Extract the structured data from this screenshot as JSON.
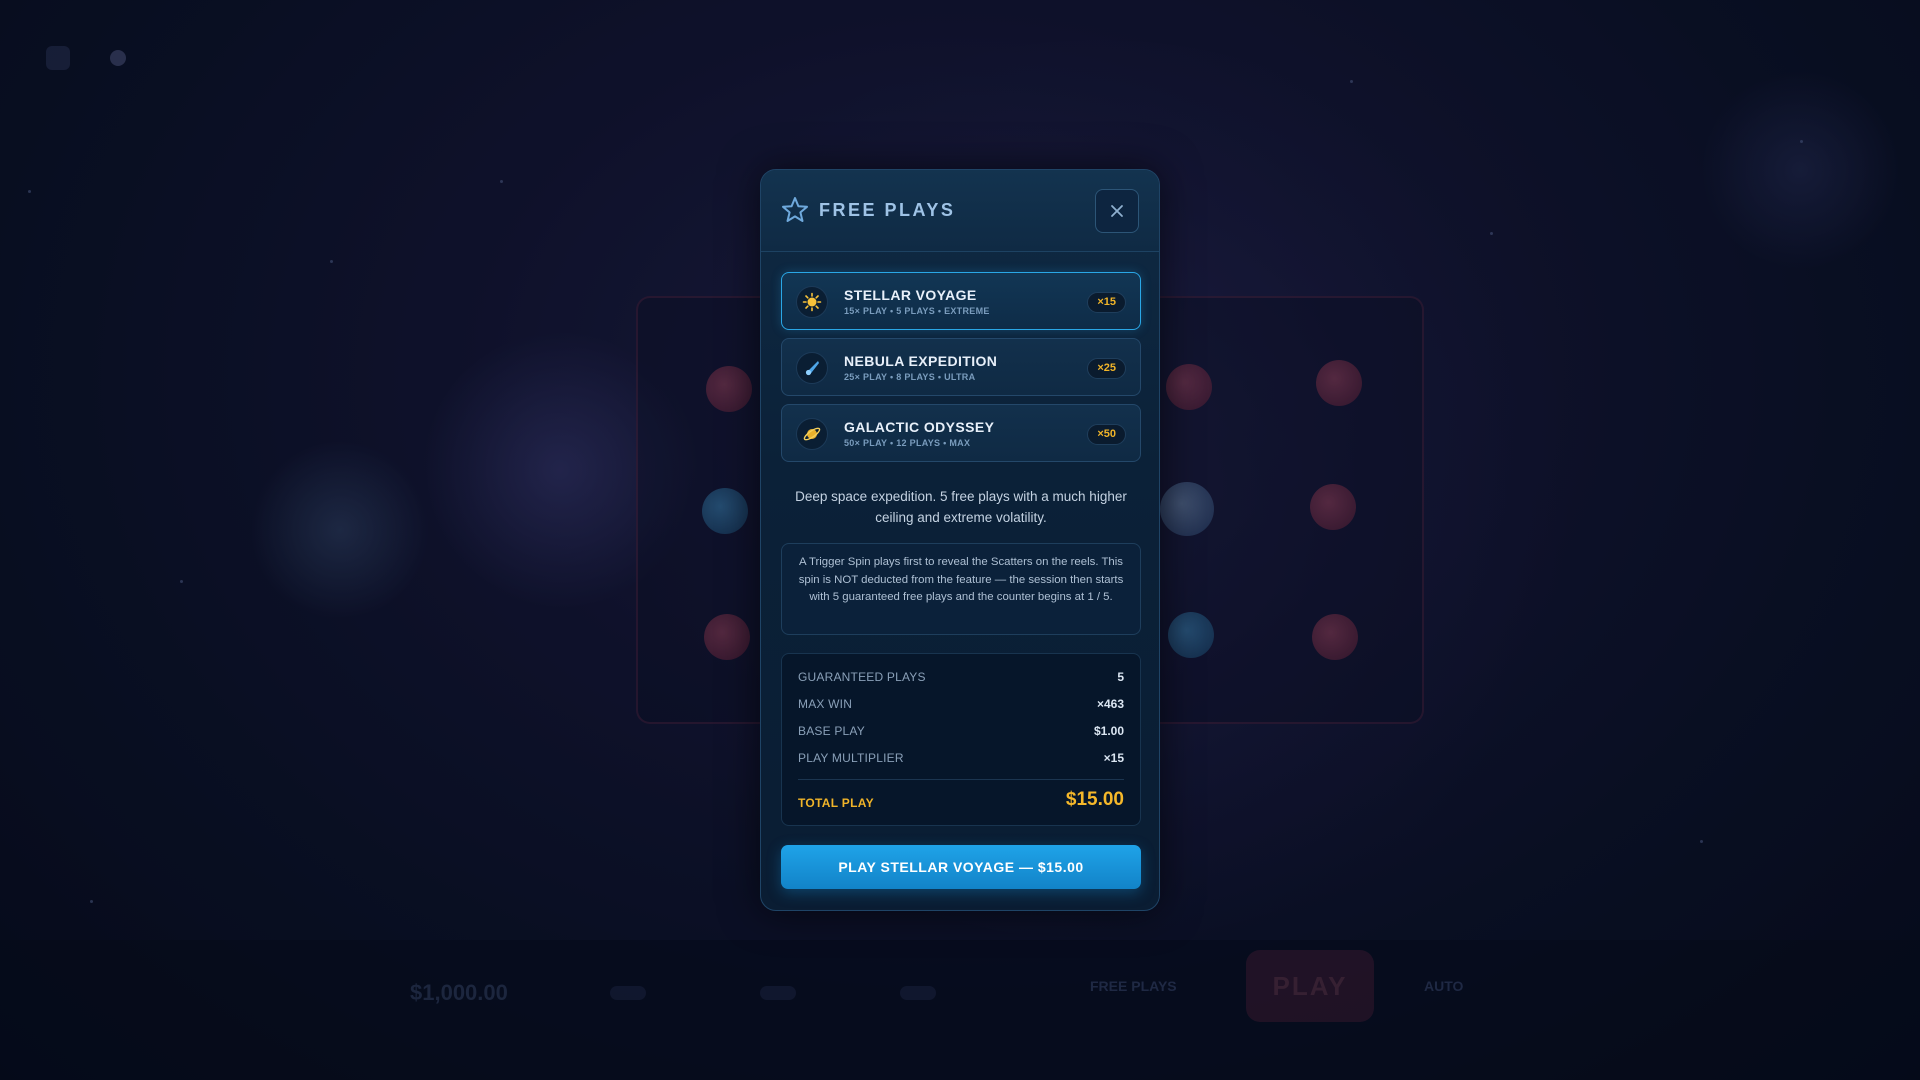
{
  "modal": {
    "title": "FREE PLAYS",
    "title_icon": "star-icon",
    "close_icon": "close-icon",
    "options": [
      {
        "name": "STELLAR VOYAGE",
        "meta": "15× PLAY • 5 PLAYS • EXTREME",
        "badge": "×15",
        "icon": "sun-icon",
        "selected": true
      },
      {
        "name": "NEBULA EXPEDITION",
        "meta": "25× PLAY • 8 PLAYS • ULTRA",
        "badge": "×25",
        "icon": "comet-icon",
        "selected": false
      },
      {
        "name": "GALACTIC ODYSSEY",
        "meta": "50× PLAY • 12 PLAYS • MAX",
        "badge": "×50",
        "icon": "planet-icon",
        "selected": false
      }
    ],
    "description": "Deep space expedition. 5 free plays with a much higher ceiling and extreme volatility.",
    "note": "A Trigger Spin plays first to reveal the Scatters on the reels. This spin is NOT deducted from the feature — the session then starts with 5 guaranteed free plays and the counter begins at 1 / 5.",
    "stats": [
      {
        "label": "GUARANTEED PLAYS",
        "value": "5"
      },
      {
        "label": "MAX WIN",
        "value": "×463"
      },
      {
        "label": "BASE PLAY",
        "value": "$1.00"
      },
      {
        "label": "PLAY MULTIPLIER",
        "value": "×15"
      }
    ],
    "total": {
      "label": "TOTAL PLAY",
      "value": "$15.00"
    },
    "cta_label": "PLAY STELLAR VOYAGE — $15.00"
  },
  "background": {
    "balance": "$1,000.00",
    "play_button": "PLAY",
    "free_plays_label": "FREE PLAYS",
    "auto_label": "AUTO"
  },
  "colors": {
    "accent": "#1fa3e8",
    "gold": "#f5b82a",
    "panel": "#0b2138"
  }
}
